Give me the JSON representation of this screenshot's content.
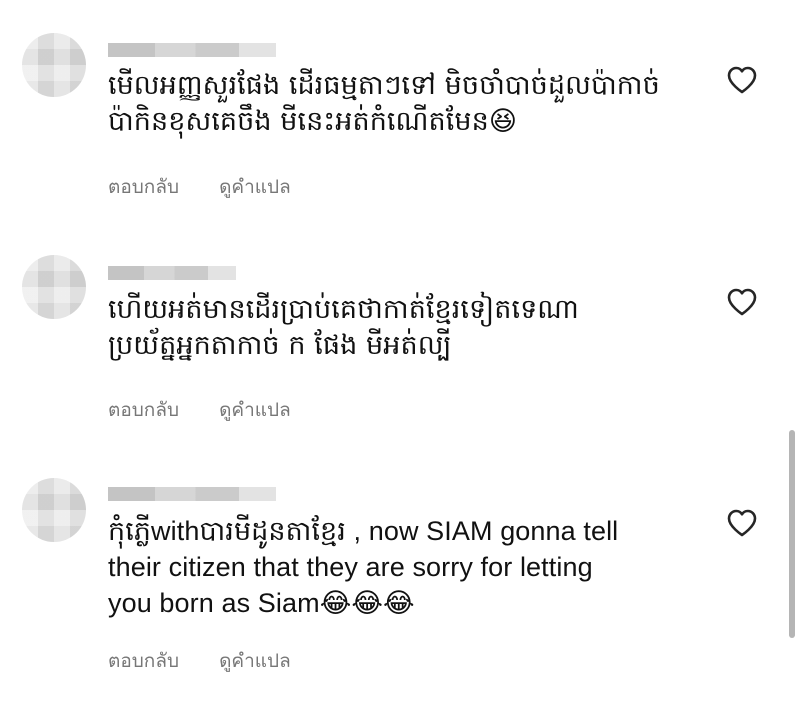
{
  "comments": [
    {
      "text": "មើលអញ្ញសួរផែង ដើរធម្មតាៗទៅ មិចចាំបាច់ដួលប៉ាកាច់\nប៉ាកិនខុសគេចឹង មីនេះអត់កំណើតមែន😆",
      "reply_label": "ตอบกลับ",
      "translate_label": "ดูคำแปล",
      "like_icon": "heart-outline-icon"
    },
    {
      "text": "ហើយអត់មានដើរប្រាប់គេថាកាត់ខ្មែរទៀតទេណា\nប្រយ័ត្នអ្នកតាកាច់ ក ផែង មីអត់ល្បី",
      "reply_label": "ตอบกลับ",
      "translate_label": "ดูคำแปล",
      "like_icon": "heart-outline-icon"
    },
    {
      "text": "កុំភ្លើwithបារមីដូនតាខ្មែរ , now SIAM gonna tell\ntheir citizen that they are sorry for letting\nyou born as Siam😂😂😂",
      "reply_label": "ตอบกลับ",
      "translate_label": "ดูคำแปล",
      "like_icon": "heart-outline-icon"
    }
  ]
}
